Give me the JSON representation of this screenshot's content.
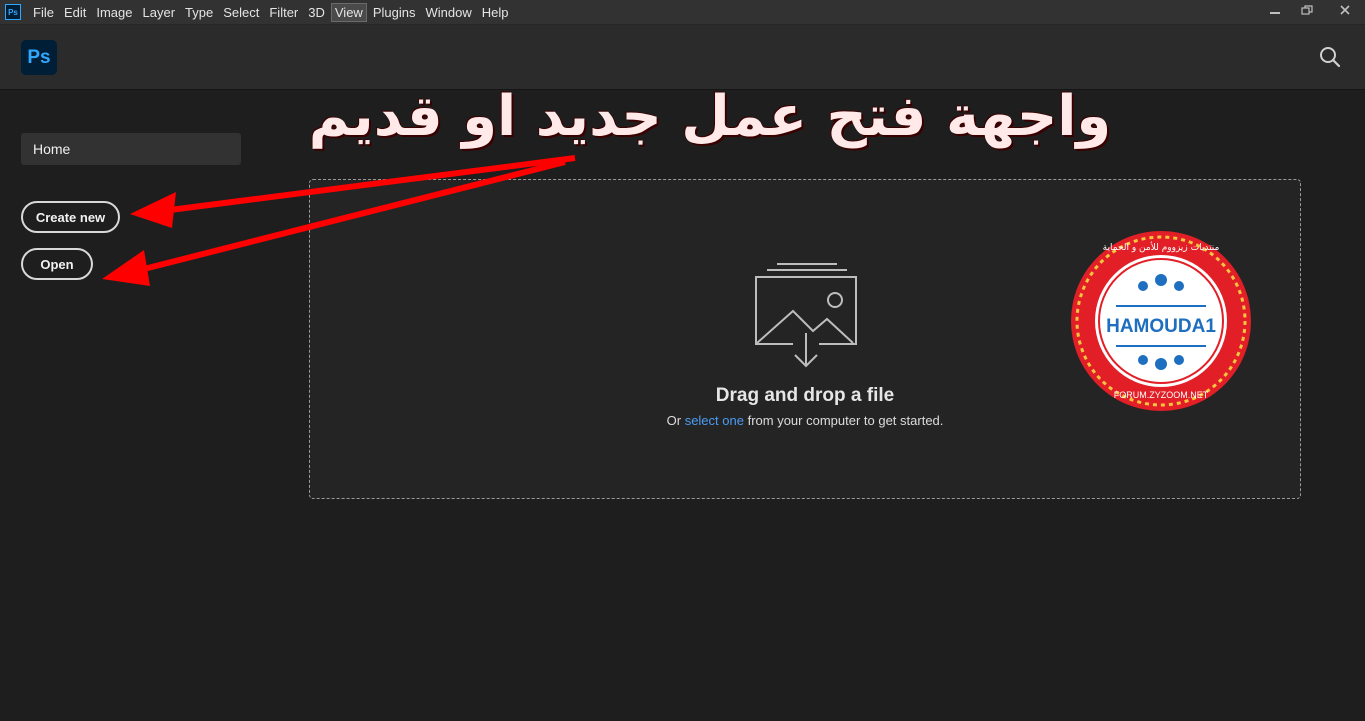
{
  "menubar": {
    "app_icon": "Ps",
    "items": [
      "File",
      "Edit",
      "Image",
      "Layer",
      "Type",
      "Select",
      "Filter",
      "3D",
      "View",
      "Plugins",
      "Window",
      "Help"
    ],
    "active": "View",
    "window_controls": [
      "minimize-icon",
      "restore-icon",
      "close-icon"
    ]
  },
  "header": {
    "logo_text": "Ps",
    "search_icon": "search-icon"
  },
  "sidebar": {
    "home_label": "Home",
    "create_new_label": "Create new",
    "open_label": "Open"
  },
  "dropzone": {
    "icon": "image-download-icon",
    "title": "Drag and drop a file",
    "sub_before": "Or",
    "sub_link": "select one",
    "sub_after": "from your computer to get started."
  },
  "annotation": {
    "title": "واجهة فتح عمل جديد او قديم",
    "arrow_color": "#ff0000"
  },
  "stamp": {
    "center_text": "HAMOUDA1",
    "bottom_text": "FORUM.ZYZOOM.NET",
    "top_text": "منتديات زيزووم للأمن و الحماية",
    "color": "#e21f26"
  },
  "colors": {
    "background": "#1e1e1e",
    "header": "#2b2b2b",
    "accent": "#31a8ff",
    "link": "#4b9cf5"
  }
}
